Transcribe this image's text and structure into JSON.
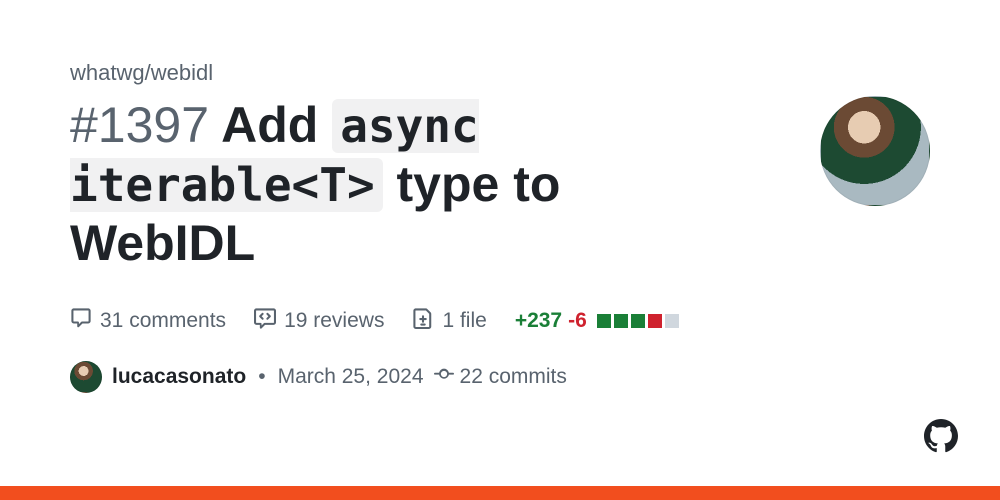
{
  "repo": "whatwg/webidl",
  "issue_number": "#1397",
  "title_segments": [
    {
      "text": "Add ",
      "code": false
    },
    {
      "text": "async iterable<T>",
      "code": true
    },
    {
      "text": " type to WebIDL",
      "code": false
    }
  ],
  "stats": {
    "comments": {
      "count": 31,
      "label": "31 comments"
    },
    "reviews": {
      "count": 19,
      "label": "19 reviews"
    },
    "files": {
      "count": 1,
      "label": "1 file"
    },
    "diff": {
      "additions": 237,
      "deletions": 6,
      "add_label": "+237",
      "del_label": "-6",
      "blocks": [
        "g",
        "g",
        "g",
        "r",
        "n"
      ]
    }
  },
  "author": {
    "username": "lucacasonato",
    "date": "March 25, 2024",
    "commits": {
      "count": 22,
      "label": "22 commits"
    }
  },
  "accent_color": "#f24e1e"
}
